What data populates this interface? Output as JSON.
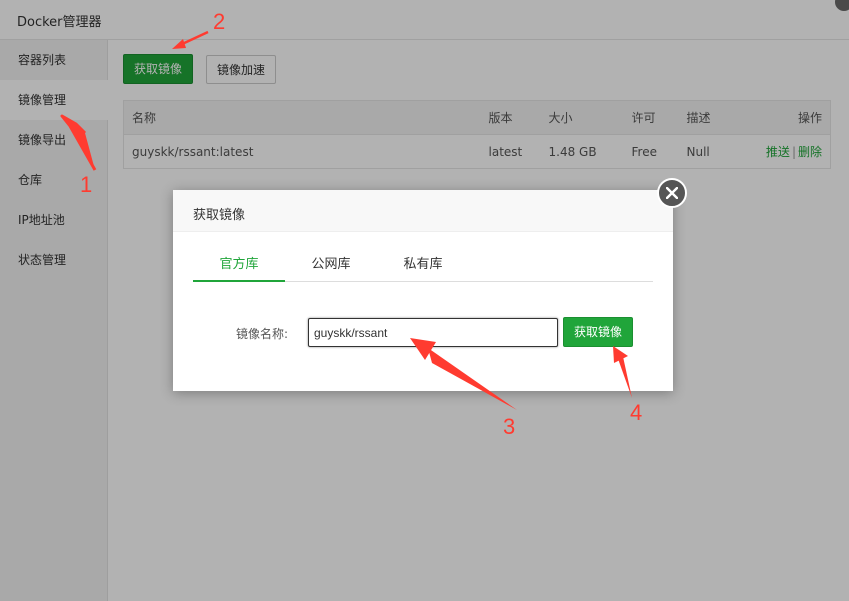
{
  "window": {
    "title": "Docker管理器"
  },
  "sidebar": {
    "items": [
      {
        "label": "容器列表",
        "active": false
      },
      {
        "label": "镜像管理",
        "active": true
      },
      {
        "label": "镜像导出",
        "active": false
      },
      {
        "label": "仓库",
        "active": false
      },
      {
        "label": "IP地址池",
        "active": false
      },
      {
        "label": "状态管理",
        "active": false
      }
    ]
  },
  "toolbar": {
    "pull_label": "获取镜像",
    "accelerate_label": "镜像加速"
  },
  "table": {
    "headers": [
      "名称",
      "版本",
      "大小",
      "许可",
      "描述",
      "操作"
    ],
    "rows": [
      {
        "name": "guyskk/rssant:latest",
        "version": "latest",
        "size": "1.48 GB",
        "license": "Free",
        "description": "Null",
        "actions": [
          "推送",
          "删除"
        ]
      }
    ]
  },
  "modal": {
    "title": "获取镜像",
    "tabs": [
      "官方库",
      "公网库",
      "私有库"
    ],
    "active_tab": "官方库",
    "field_label": "镜像名称:",
    "field_value": "guyskk/rssant",
    "submit_label": "获取镜像"
  },
  "annotations": [
    "1",
    "2",
    "3",
    "4"
  ],
  "colors": {
    "primary": "#20a53a",
    "annotation": "#ff3b30",
    "overlay": "rgba(0,0,0,0.30)"
  }
}
